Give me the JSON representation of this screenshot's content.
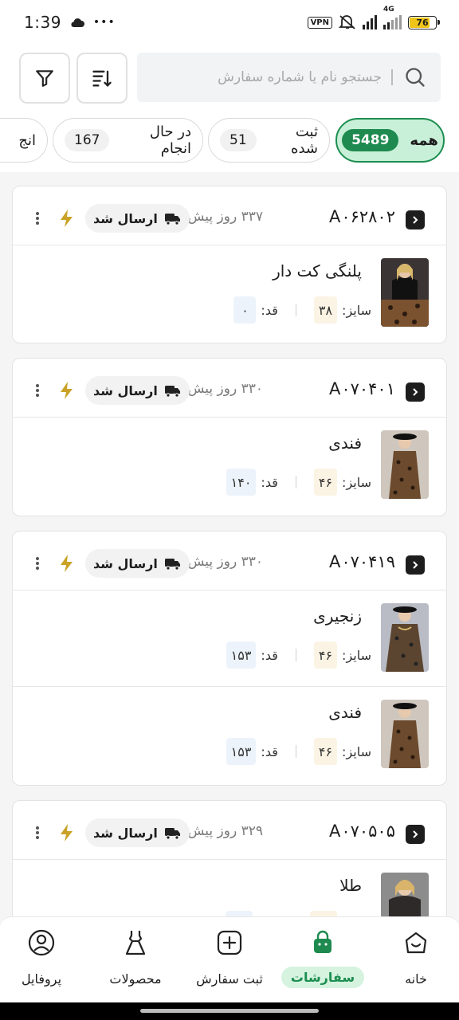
{
  "status_bar": {
    "time": "1:39",
    "dots": "•••",
    "vpn": "VPN",
    "network": "4G",
    "battery": "76"
  },
  "search": {
    "placeholder": "جستجو نام یا شماره سفارش"
  },
  "tabs": [
    {
      "label": "همه",
      "count": "5489"
    },
    {
      "label": "ثبت شده",
      "count": "51"
    },
    {
      "label": "در حال انجام",
      "count": "167"
    },
    {
      "label": "انج",
      "count": ""
    }
  ],
  "labels": {
    "size": "سایز:",
    "height": "قد:"
  },
  "orders": [
    {
      "code": "A۰۶۲۸۰۲",
      "ago": "۳۳۷ روز پیش",
      "status": "ارسال شد",
      "items": [
        {
          "name": "پلنگی کت دار",
          "size": "۳۸",
          "height": "۰"
        }
      ]
    },
    {
      "code": "A۰۷۰۴۰۱",
      "ago": "۳۳۰ روز پیش",
      "status": "ارسال شد",
      "items": [
        {
          "name": "فندی",
          "size": "۴۶",
          "height": "۱۴۰"
        }
      ]
    },
    {
      "code": "A۰۷۰۴۱۹",
      "ago": "۳۳۰ روز پیش",
      "status": "ارسال شد",
      "items": [
        {
          "name": "زنجیری",
          "size": "۴۶",
          "height": "۱۵۳"
        },
        {
          "name": "فندی",
          "size": "۴۶",
          "height": "۱۵۳"
        }
      ]
    },
    {
      "code": "A۰۷۰۵۰۵",
      "ago": "۳۲۹ روز پیش",
      "status": "ارسال شد",
      "items": [
        {
          "name": "طلا",
          "size": "",
          "height": ""
        }
      ]
    }
  ],
  "bottom_nav": [
    {
      "label": "خانه",
      "icon": "home-icon"
    },
    {
      "label": "سفارشات",
      "icon": "shopping-bag-icon"
    },
    {
      "label": "ثبت سفارش",
      "icon": "add-order-icon"
    },
    {
      "label": "محصولات",
      "icon": "dress-icon"
    },
    {
      "label": "پروفایل",
      "icon": "profile-icon"
    }
  ],
  "colors": {
    "accent": "#1e8a4f",
    "accent_light": "#c8f0d8",
    "bolt": "#c9a227"
  }
}
